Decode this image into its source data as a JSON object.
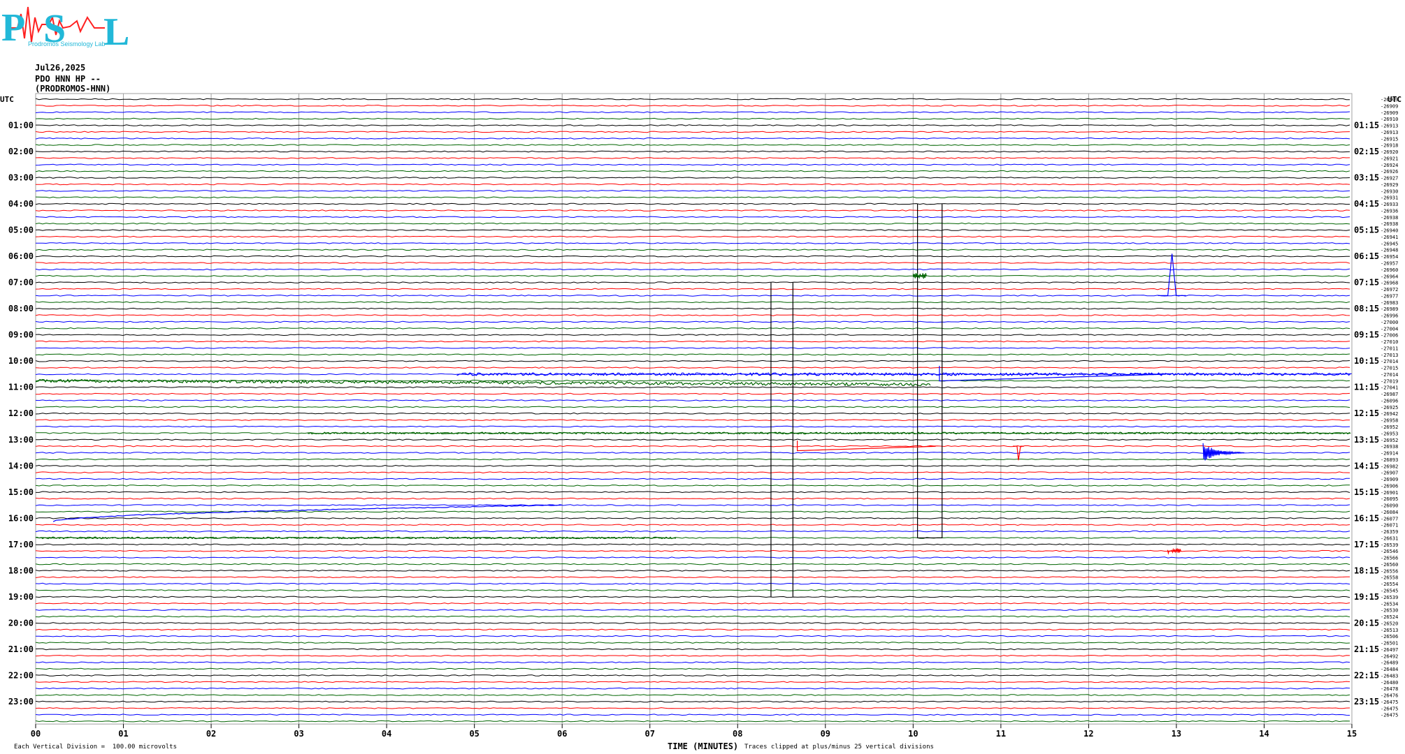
{
  "header": {
    "logo_text": "PSL",
    "logo_subtitle": "Prodromos Seismology Lab",
    "date": "Jul26,2025",
    "channel": "PDO HNN HP --",
    "station": "(PRODROMOS-HNN)"
  },
  "axes": {
    "left_title": "UTC",
    "right_title": "UTC",
    "left_hours": [
      "01:00",
      "02:00",
      "03:00",
      "04:00",
      "05:00",
      "06:00",
      "07:00",
      "08:00",
      "09:00",
      "10:00",
      "11:00",
      "12:00",
      "13:00",
      "14:00",
      "15:00",
      "16:00",
      "17:00",
      "18:00",
      "19:00",
      "20:00",
      "21:00",
      "22:00",
      "23:00"
    ],
    "right_hours": [
      "01:15",
      "02:15",
      "03:15",
      "04:15",
      "05:15",
      "06:15",
      "07:15",
      "08:15",
      "09:15",
      "10:15",
      "11:15",
      "12:15",
      "13:15",
      "14:15",
      "15:15",
      "16:15",
      "17:15",
      "18:15",
      "19:15",
      "20:15",
      "21:15",
      "22:15",
      "23:15"
    ],
    "x_ticks": [
      "00",
      "01",
      "02",
      "03",
      "04",
      "05",
      "06",
      "07",
      "08",
      "09",
      "10",
      "11",
      "12",
      "13",
      "14",
      "15"
    ]
  },
  "footer": {
    "scale": "Each Vertical Division =  100.00 microvolts",
    "xlabel": "TIME (MINUTES)",
    "clip_note": "Traces clipped at plus/minus 25 vertical divisions"
  },
  "colors": {
    "trace": [
      "#000000",
      "#ff0000",
      "#0000ff",
      "#006400"
    ],
    "grid": "#a0a0a0"
  },
  "chart_data": {
    "type": "line",
    "title": "",
    "xlabel": "TIME (MINUTES)",
    "ylabel": "UTC",
    "xlim": [
      0,
      15
    ],
    "trace_count": 96,
    "trace_minutes": 15,
    "grid": true,
    "offsets": [
      "-26909",
      "-26909",
      "-26909",
      "-26910",
      "-26913",
      "-26913",
      "-26915",
      "-26918",
      "-26920",
      "-26921",
      "-26924",
      "-26926",
      "-26927",
      "-26929",
      "-26930",
      "-26931",
      "-26933",
      "-26936",
      "-26938",
      "-26938",
      "-26940",
      "-26941",
      "-26945",
      "-26948",
      "-26954",
      "-26957",
      "-26960",
      "-26964",
      "-26968",
      "-26972",
      "-26977",
      "-26983",
      "-26989",
      "-26996",
      "-27000",
      "-27004",
      "-27006",
      "-27010",
      "-27011",
      "-27013",
      "-27014",
      "-27015",
      "-27014",
      "-27019",
      "-27041",
      "-26987",
      "-26096",
      "-26925",
      "-26942",
      "-26958",
      "-26952",
      "-26953",
      "-26952",
      "-26938",
      "-26914",
      "-26893",
      "-26982",
      "-26907",
      "-26909",
      "-26906",
      "-26901",
      "-26095",
      "-26090",
      "-26084",
      "-26077",
      "-26071",
      "-26359",
      "-26631",
      "-26539",
      "-26546",
      "-26566",
      "-26560",
      "-26556",
      "-26558",
      "-26554",
      "-26545",
      "-26539",
      "-26534",
      "-26530",
      "-26524",
      "-26520",
      "-26513",
      "-26506",
      "-26501",
      "-26497",
      "-26492",
      "-26489",
      "-26484",
      "-26483",
      "-26480",
      "-26478",
      "-26476",
      "-26475",
      "-26475",
      "-26475"
    ],
    "events": [
      {
        "type": "offset-trend",
        "trace": 43,
        "start_min": 0.0,
        "end_min": 10.2,
        "amplitude": 8
      },
      {
        "type": "noise-burst",
        "trace": 42,
        "start_min": 4.8,
        "end_min": 15.0,
        "amplitude": 3
      },
      {
        "type": "step-recovery",
        "trace": 42,
        "at_min": 10.3,
        "end_min": 12.9,
        "amplitude": 12
      },
      {
        "type": "spike",
        "trace": 30,
        "at_min": 12.95,
        "amplitude": 60
      },
      {
        "type": "box-step",
        "trace": 16,
        "start_min": 10.05,
        "end_min": 10.33,
        "to_trace": 67
      },
      {
        "type": "clip-line",
        "trace": 28,
        "at_min": 8.38,
        "to_trace": 76
      },
      {
        "type": "clip-line",
        "trace": 28,
        "at_min": 8.63,
        "to_trace": 76
      },
      {
        "type": "step-recovery",
        "trace": 53,
        "at_min": 8.68,
        "end_min": 10.3,
        "amplitude": 8
      },
      {
        "type": "dip",
        "trace": 53,
        "at_min": 11.2,
        "amplitude": 20
      },
      {
        "type": "quake",
        "trace": 54,
        "at_min": 13.4,
        "amplitude": 14
      },
      {
        "type": "ramp",
        "trace": 62,
        "start_min": 0.2,
        "end_min": 6.0,
        "amplitude": 24
      },
      {
        "type": "noise-burst",
        "trace": 51,
        "start_min": 3.1,
        "end_min": 15.0,
        "amplitude": 2
      },
      {
        "type": "noise-burst",
        "trace": 67,
        "start_min": 0.0,
        "end_min": 7.3,
        "amplitude": 2
      },
      {
        "type": "blip",
        "trace": 27,
        "at_min": 10.0,
        "amplitude": 4
      },
      {
        "type": "blip",
        "trace": 69,
        "at_min": 12.9,
        "amplitude": 4
      }
    ]
  }
}
